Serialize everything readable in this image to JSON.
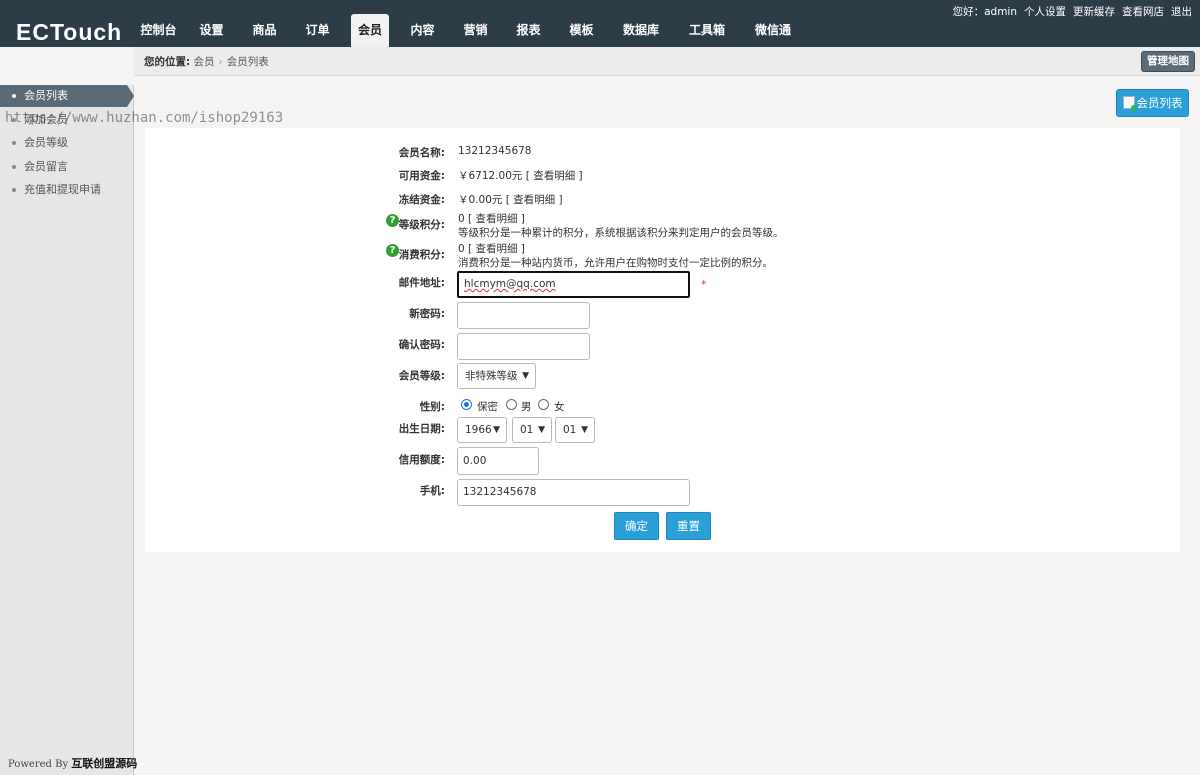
{
  "app": {
    "logo": "ECTouch"
  },
  "nav": {
    "items": [
      "控制台",
      "设置",
      "商品",
      "订单",
      "会员",
      "内容",
      "营销",
      "报表",
      "模板",
      "数据库",
      "工具箱",
      "微信通"
    ],
    "active": "会员"
  },
  "toplinks": {
    "greeting": "您好：admin",
    "profile": "个人设置",
    "cache": "更新缓存",
    "view_site": "查看网店",
    "logout": "退出"
  },
  "breadcrumb": {
    "prefix": "您的位置:",
    "level1": "会员",
    "level2": "会员列表"
  },
  "map_button": "管理地图",
  "sidebar": {
    "items": [
      "会员列表",
      "添加会员",
      "会员等级",
      "会员留言",
      "充值和提现申请"
    ],
    "active": "会员列表",
    "powered_prefix": "Powered By",
    "powered_name": "互联创盟源码"
  },
  "watermark": "https://www.huzhan.com/ishop29163",
  "list_button": "会员列表",
  "form": {
    "username_label": "会员名称:",
    "username": "13212345678",
    "funds_label": "可用资金:",
    "funds": "￥6712.00元 [ 查看明细 ]",
    "frozen_label": "冻结资金:",
    "frozen": "￥0.00元 [ 查看明细 ]",
    "rank_points_label": "等级积分:",
    "rank_points": "0 [ 查看明细 ]",
    "rank_points_note": "等级积分是一种累计的积分，系统根据该积分来判定用户的会员等级。",
    "pay_points_label": "消费积分:",
    "pay_points": "0 [ 查看明细 ]",
    "pay_points_note": "消费积分是一种站内货币，允许用户在购物时支付一定比例的积分。",
    "email_label": "邮件地址:",
    "email": "hlcmym@qq.com",
    "required_mark": "*",
    "new_password_label": "新密码:",
    "confirm_password_label": "确认密码:",
    "rank_label": "会员等级:",
    "rank_value": "非特殊等级",
    "gender_label": "性别:",
    "gender_options": [
      "保密",
      "男",
      "女"
    ],
    "gender_selected": "保密",
    "birthday_label": "出生日期:",
    "birth_year": "1966",
    "birth_month": "01",
    "birth_day": "01",
    "credit_label": "信用额度:",
    "credit": "0.00",
    "mobile_label": "手机:",
    "mobile": "13212345678",
    "submit": "确定",
    "reset": "重置"
  },
  "colors": {
    "header": "#2c3d48",
    "accent": "#2a9fd8",
    "help": "#2fa12f",
    "required": "#e03030"
  }
}
